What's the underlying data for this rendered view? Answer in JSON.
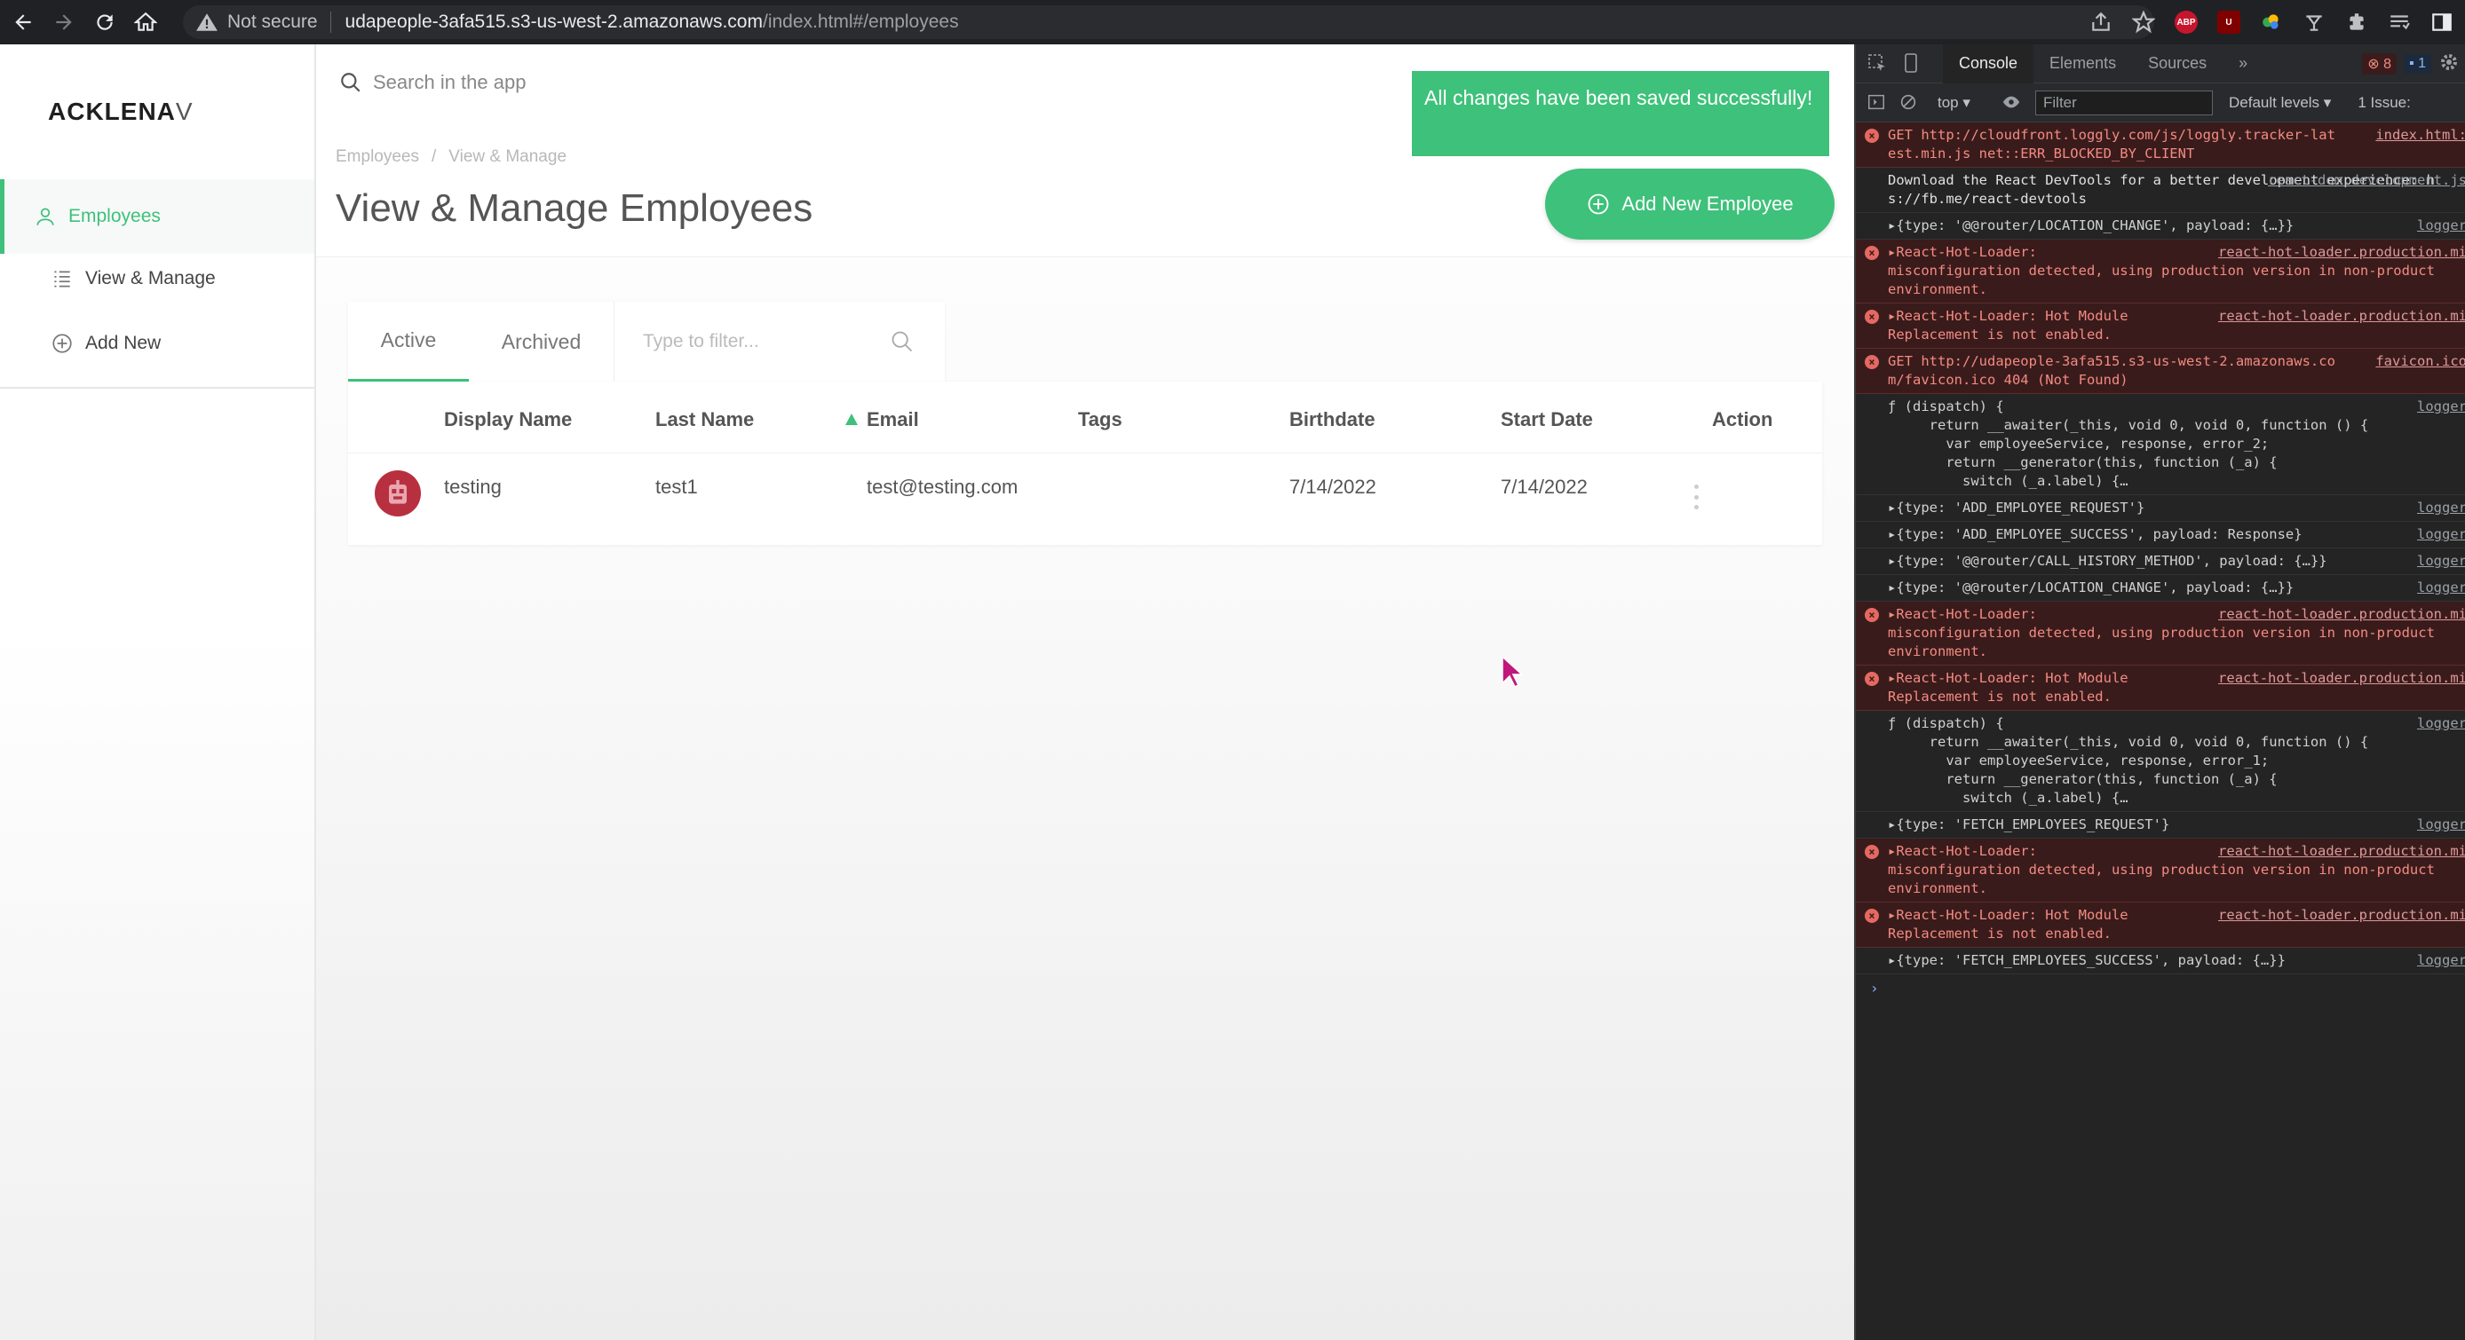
{
  "browser": {
    "security_label": "Not secure",
    "url_host": "udapeople-3afa515.s3-us-west-2.amazonaws.com",
    "url_path": "/index.html#/employees",
    "ext_abp_label": "ABP",
    "ext_ub_label": "U"
  },
  "app": {
    "logo_main": "ACKLENA",
    "logo_last": "V",
    "sidebar": {
      "items": [
        {
          "label": "Employees",
          "icon": "user-icon"
        },
        {
          "label": "View & Manage",
          "icon": "list-icon"
        },
        {
          "label": "Add New",
          "icon": "plus-circle-icon"
        }
      ]
    },
    "search_placeholder": "Search in the app",
    "breadcrumb": [
      "Employees",
      "/",
      "View & Manage"
    ],
    "page_title": "View & Manage Employees",
    "toast": "All changes have been saved successfully!",
    "add_button_label": "Add New Employee",
    "tabs": [
      "Active",
      "Archived"
    ],
    "filter_placeholder": "Type to filter...",
    "table": {
      "columns": [
        "Display Name",
        "Last Name",
        "Email",
        "Tags",
        "Birthdate",
        "Start Date",
        "Action"
      ],
      "rows": [
        {
          "display_name": "testing",
          "last_name": "test1",
          "email": "test@testing.com",
          "tags": "",
          "birthdate": "7/14/2022",
          "start_date": "7/14/2022"
        }
      ]
    },
    "accent_color": "#3ec17a"
  },
  "devtools": {
    "tabs": [
      "Console",
      "Elements",
      "Sources",
      "»"
    ],
    "error_count": "8",
    "message_count": "1",
    "context": "top ▾",
    "filter_placeholder": "Filter",
    "levels": "Default levels ▾",
    "issues": "1 Issue:",
    "logs": [
      {
        "kind": "err",
        "text": "GET http://cloudfront.loggly.com/js/loggly.tracker-lat\nest.min.js net::ERR_BLOCKED_BY_CLIENT",
        "src": "index.html:"
      },
      {
        "kind": "info",
        "text": "Download the React DevTools for a better development experience: h\ns://fb.me/react-devtools",
        "src": "react-dom.development.js"
      },
      {
        "kind": "obj",
        "text": "▸{type: '@@router/LOCATION_CHANGE', payload: {…}}",
        "src": "logger"
      },
      {
        "kind": "err",
        "text": "▸React-Hot-Loader:\nmisconfiguration detected, using production version in non-product\nenvironment.",
        "src": "react-hot-loader.production.mi"
      },
      {
        "kind": "err",
        "text": "▸React-Hot-Loader: Hot Module\nReplacement is not enabled.",
        "src": "react-hot-loader.production.mi"
      },
      {
        "kind": "err",
        "text": "GET http://udapeople-3afa515.s3-us-west-2.amazonaws.co\nm/favicon.ico 404 (Not Found)",
        "src": "favicon.ico"
      },
      {
        "kind": "obj",
        "text": "ƒ (dispatch) {\n     return __awaiter(_this, void 0, void 0, function () {\n       var employeeService, response, error_2;\n       return __generator(this, function (_a) {\n         switch (_a.label) {…",
        "src": "logger"
      },
      {
        "kind": "obj",
        "text": "▸{type: 'ADD_EMPLOYEE_REQUEST'}",
        "src": "logger"
      },
      {
        "kind": "obj",
        "text": "▸{type: 'ADD_EMPLOYEE_SUCCESS', payload: Response}",
        "src": "logger"
      },
      {
        "kind": "obj",
        "text": "▸{type: '@@router/CALL_HISTORY_METHOD', payload: {…}}",
        "src": "logger"
      },
      {
        "kind": "obj",
        "text": "▸{type: '@@router/LOCATION_CHANGE', payload: {…}}",
        "src": "logger"
      },
      {
        "kind": "err",
        "text": "▸React-Hot-Loader:\nmisconfiguration detected, using production version in non-product\nenvironment.",
        "src": "react-hot-loader.production.mi"
      },
      {
        "kind": "err",
        "text": "▸React-Hot-Loader: Hot Module\nReplacement is not enabled.",
        "src": "react-hot-loader.production.mi"
      },
      {
        "kind": "obj",
        "text": "ƒ (dispatch) {\n     return __awaiter(_this, void 0, void 0, function () {\n       var employeeService, response, error_1;\n       return __generator(this, function (_a) {\n         switch (_a.label) {…",
        "src": "logger"
      },
      {
        "kind": "obj",
        "text": "▸{type: 'FETCH_EMPLOYEES_REQUEST'}",
        "src": "logger"
      },
      {
        "kind": "err",
        "text": "▸React-Hot-Loader:\nmisconfiguration detected, using production version in non-product\nenvironment.",
        "src": "react-hot-loader.production.mi"
      },
      {
        "kind": "err",
        "text": "▸React-Hot-Loader: Hot Module\nReplacement is not enabled.",
        "src": "react-hot-loader.production.mi"
      },
      {
        "kind": "obj",
        "text": "▸{type: 'FETCH_EMPLOYEES_SUCCESS', payload: {…}}",
        "src": "logger"
      }
    ],
    "prompt": "›"
  }
}
